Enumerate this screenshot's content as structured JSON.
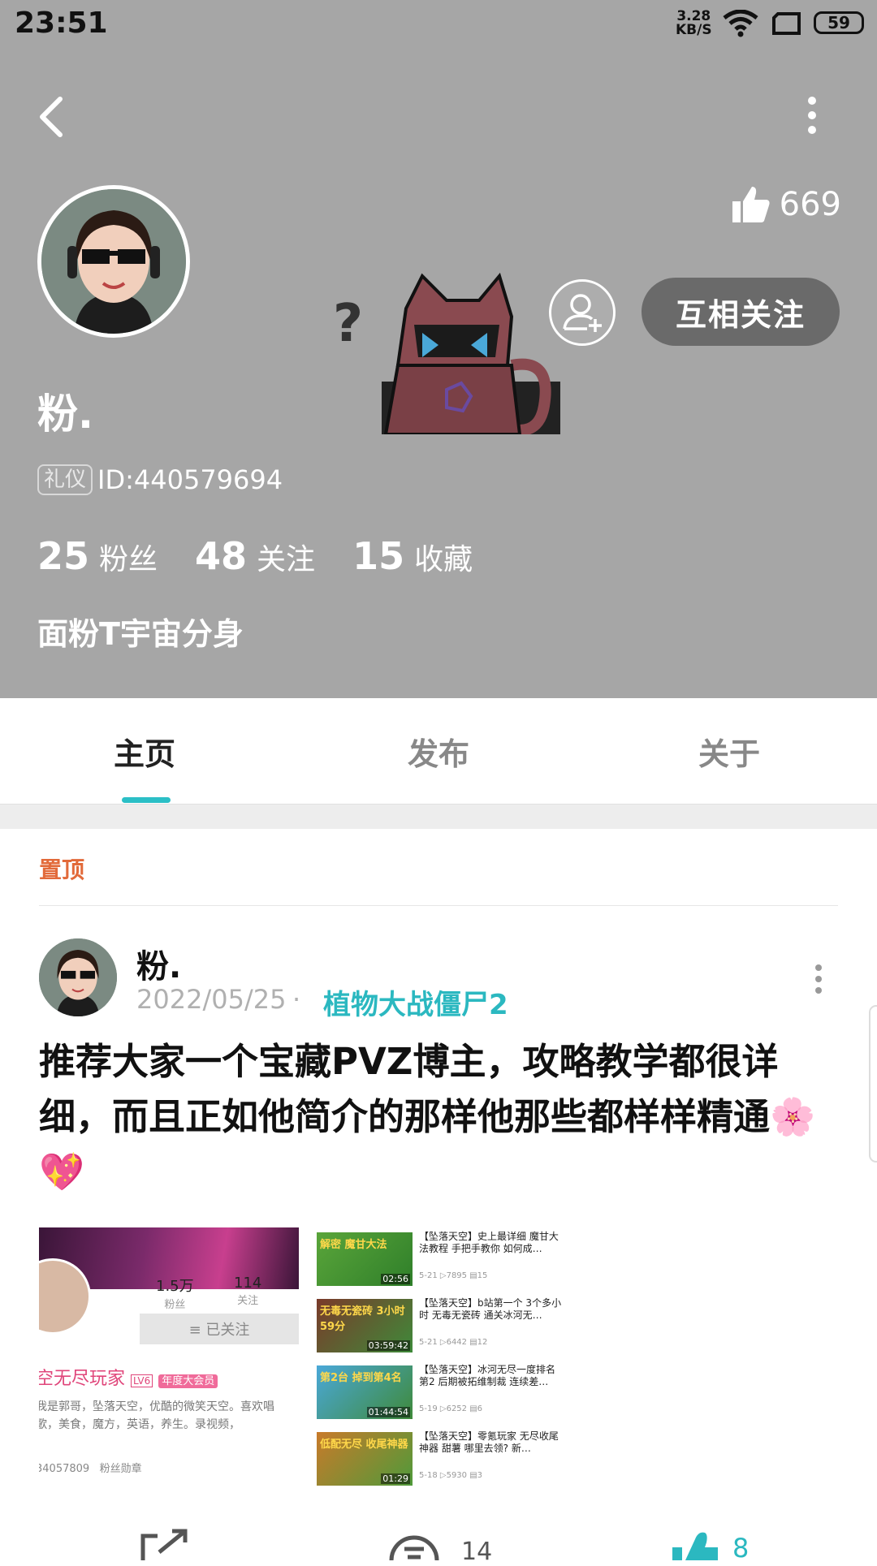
{
  "status_bar": {
    "time": "23:51",
    "speed_value": "3.28",
    "speed_unit": "KB/S",
    "battery": "59"
  },
  "profile": {
    "likes": "669",
    "username": "粉.",
    "badge": "礼仪",
    "user_id": "ID:440579694",
    "stats": [
      {
        "value": "25",
        "label": "粉丝"
      },
      {
        "value": "48",
        "label": "关注"
      },
      {
        "value": "15",
        "label": "收藏"
      }
    ],
    "bio": "面粉T宇宙分身",
    "mutual_follow_label": "互相关注"
  },
  "tabs": [
    {
      "label": "主页"
    },
    {
      "label": "发布"
    },
    {
      "label": "关于"
    }
  ],
  "active_tab": "主页",
  "colors": {
    "accent": "#2bbfc6",
    "pinned": "#e26a3a",
    "header_bg": "#a6a6a6"
  },
  "pinned_label": "置顶",
  "post": {
    "author": "粉.",
    "date": "2022/05/25",
    "separator": "·",
    "topic": "植物大战僵尸2",
    "text": "推荐大家一个宝藏PVZ博主，攻略教学都很详细，而且正如他简介的那样他那些都样样精通🌸💖",
    "comments": "14",
    "likes": "8"
  },
  "screenshot_left": {
    "fans": "1.5万",
    "fans_label": "粉丝",
    "follow": "114",
    "follow_label": "关注",
    "followed_button": "≡ 已关注",
    "name": "空无尽玩家",
    "level": "LV6",
    "vip": "年度大会员",
    "bio": "我是郭哥，坠落天空，优酷的微笑天空。喜欢唱歌，美食，魔方，英语，养生。录视频，",
    "footer_id": "34057809",
    "footer_label": "粉丝勋章"
  },
  "screenshot_right": {
    "videos": [
      {
        "caption": "解密 魔甘大法",
        "duration": "02:56",
        "title": "【坠落天空】史上最详细 魔甘大法教程 手把手教你 如何成…",
        "date": "5-21",
        "views": "7895",
        "danmaku": "15"
      },
      {
        "caption": "无毒无瓷砖 3小时59分",
        "duration": "03:59:42",
        "title": "【坠落天空】b站第一个 3个多小时 无毒无瓷砖 通关冰河无…",
        "date": "5-21",
        "views": "6442",
        "danmaku": "12"
      },
      {
        "caption": "第2台 掉到第4名",
        "duration": "01:44:54",
        "title": "【坠落天空】冰河无尽一度排名第2 后期被拓维制裁 连续差…",
        "date": "5-19",
        "views": "6252",
        "danmaku": "6"
      },
      {
        "caption": "低配无尽 收尾神器",
        "duration": "01:29",
        "title": "【坠落天空】零氪玩家 无尽收尾神器  甜薯 哪里去领? 新…",
        "date": "5-18",
        "views": "5930",
        "danmaku": "3"
      }
    ]
  }
}
